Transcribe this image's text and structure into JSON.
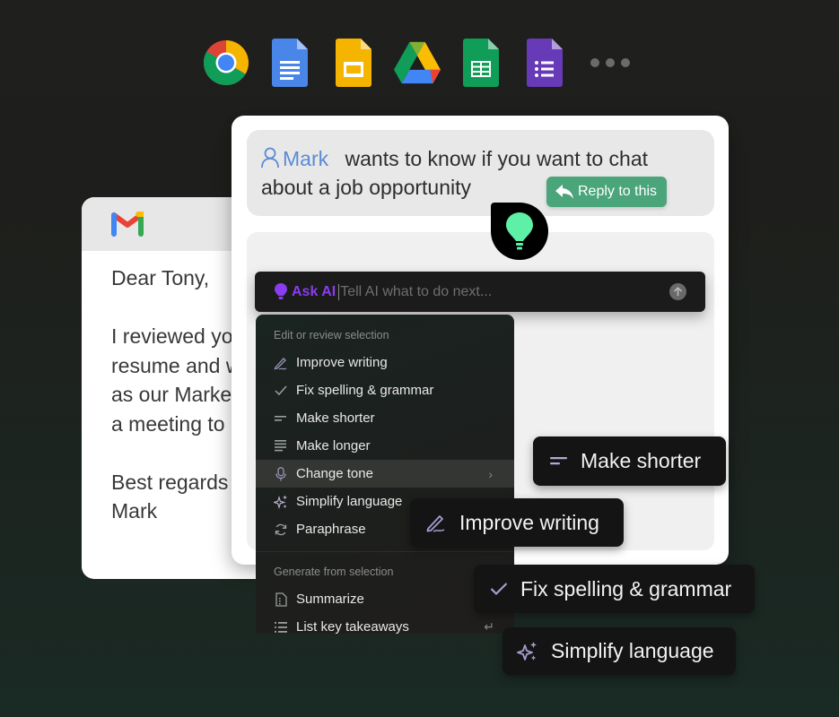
{
  "dock": {
    "apps": [
      {
        "name": "Chrome",
        "icon": "chrome-icon"
      },
      {
        "name": "Google Docs",
        "icon": "docs-icon"
      },
      {
        "name": "Google Slides",
        "icon": "slides-icon"
      },
      {
        "name": "Google Drive",
        "icon": "drive-icon"
      },
      {
        "name": "Google Sheets",
        "icon": "sheets-icon"
      },
      {
        "name": "Google Forms",
        "icon": "forms-icon"
      }
    ],
    "more_icon": "more-dots-icon"
  },
  "gmail": {
    "icon": "gmail-icon",
    "greeting": "Dear Tony,",
    "body_lines": [
      "I reviewed yo",
      "resume and w",
      "as our Marke",
      "a meeting to"
    ],
    "closing": "Best regards",
    "signature": "Mark"
  },
  "notification": {
    "sender": "Mark",
    "message": "wants to know if you want to chat about a job opportunity",
    "reply_button": "Reply to this",
    "accent": "#4aa57b"
  },
  "ask_ai": {
    "label": "Ask AI",
    "placeholder": "Tell AI what to do next...",
    "accent": "#8a3cf0"
  },
  "menu": {
    "sections": [
      {
        "title": "Edit or review selection",
        "items": [
          {
            "label": "Improve writing",
            "icon": "pen-icon"
          },
          {
            "label": "Fix spelling & grammar",
            "icon": "check-icon"
          },
          {
            "label": "Make shorter",
            "icon": "short-lines-icon"
          },
          {
            "label": "Make longer",
            "icon": "long-lines-icon"
          },
          {
            "label": "Change tone",
            "icon": "microphone-icon",
            "submenu": true
          },
          {
            "label": "Simplify language",
            "icon": "sparkles-icon"
          },
          {
            "label": "Paraphrase",
            "icon": "refresh-icon"
          }
        ]
      },
      {
        "title": "Generate from selection",
        "items": [
          {
            "label": "Summarize",
            "icon": "document-icon"
          },
          {
            "label": "List key takeaways",
            "icon": "list-icon"
          }
        ]
      }
    ]
  },
  "chips": [
    {
      "label": "Make shorter",
      "icon": "short-lines-icon"
    },
    {
      "label": "Improve writing",
      "icon": "pen-icon"
    },
    {
      "label": "Fix spelling & grammar",
      "icon": "check-icon"
    },
    {
      "label": "Simplify language",
      "icon": "sparkles-icon"
    }
  ]
}
